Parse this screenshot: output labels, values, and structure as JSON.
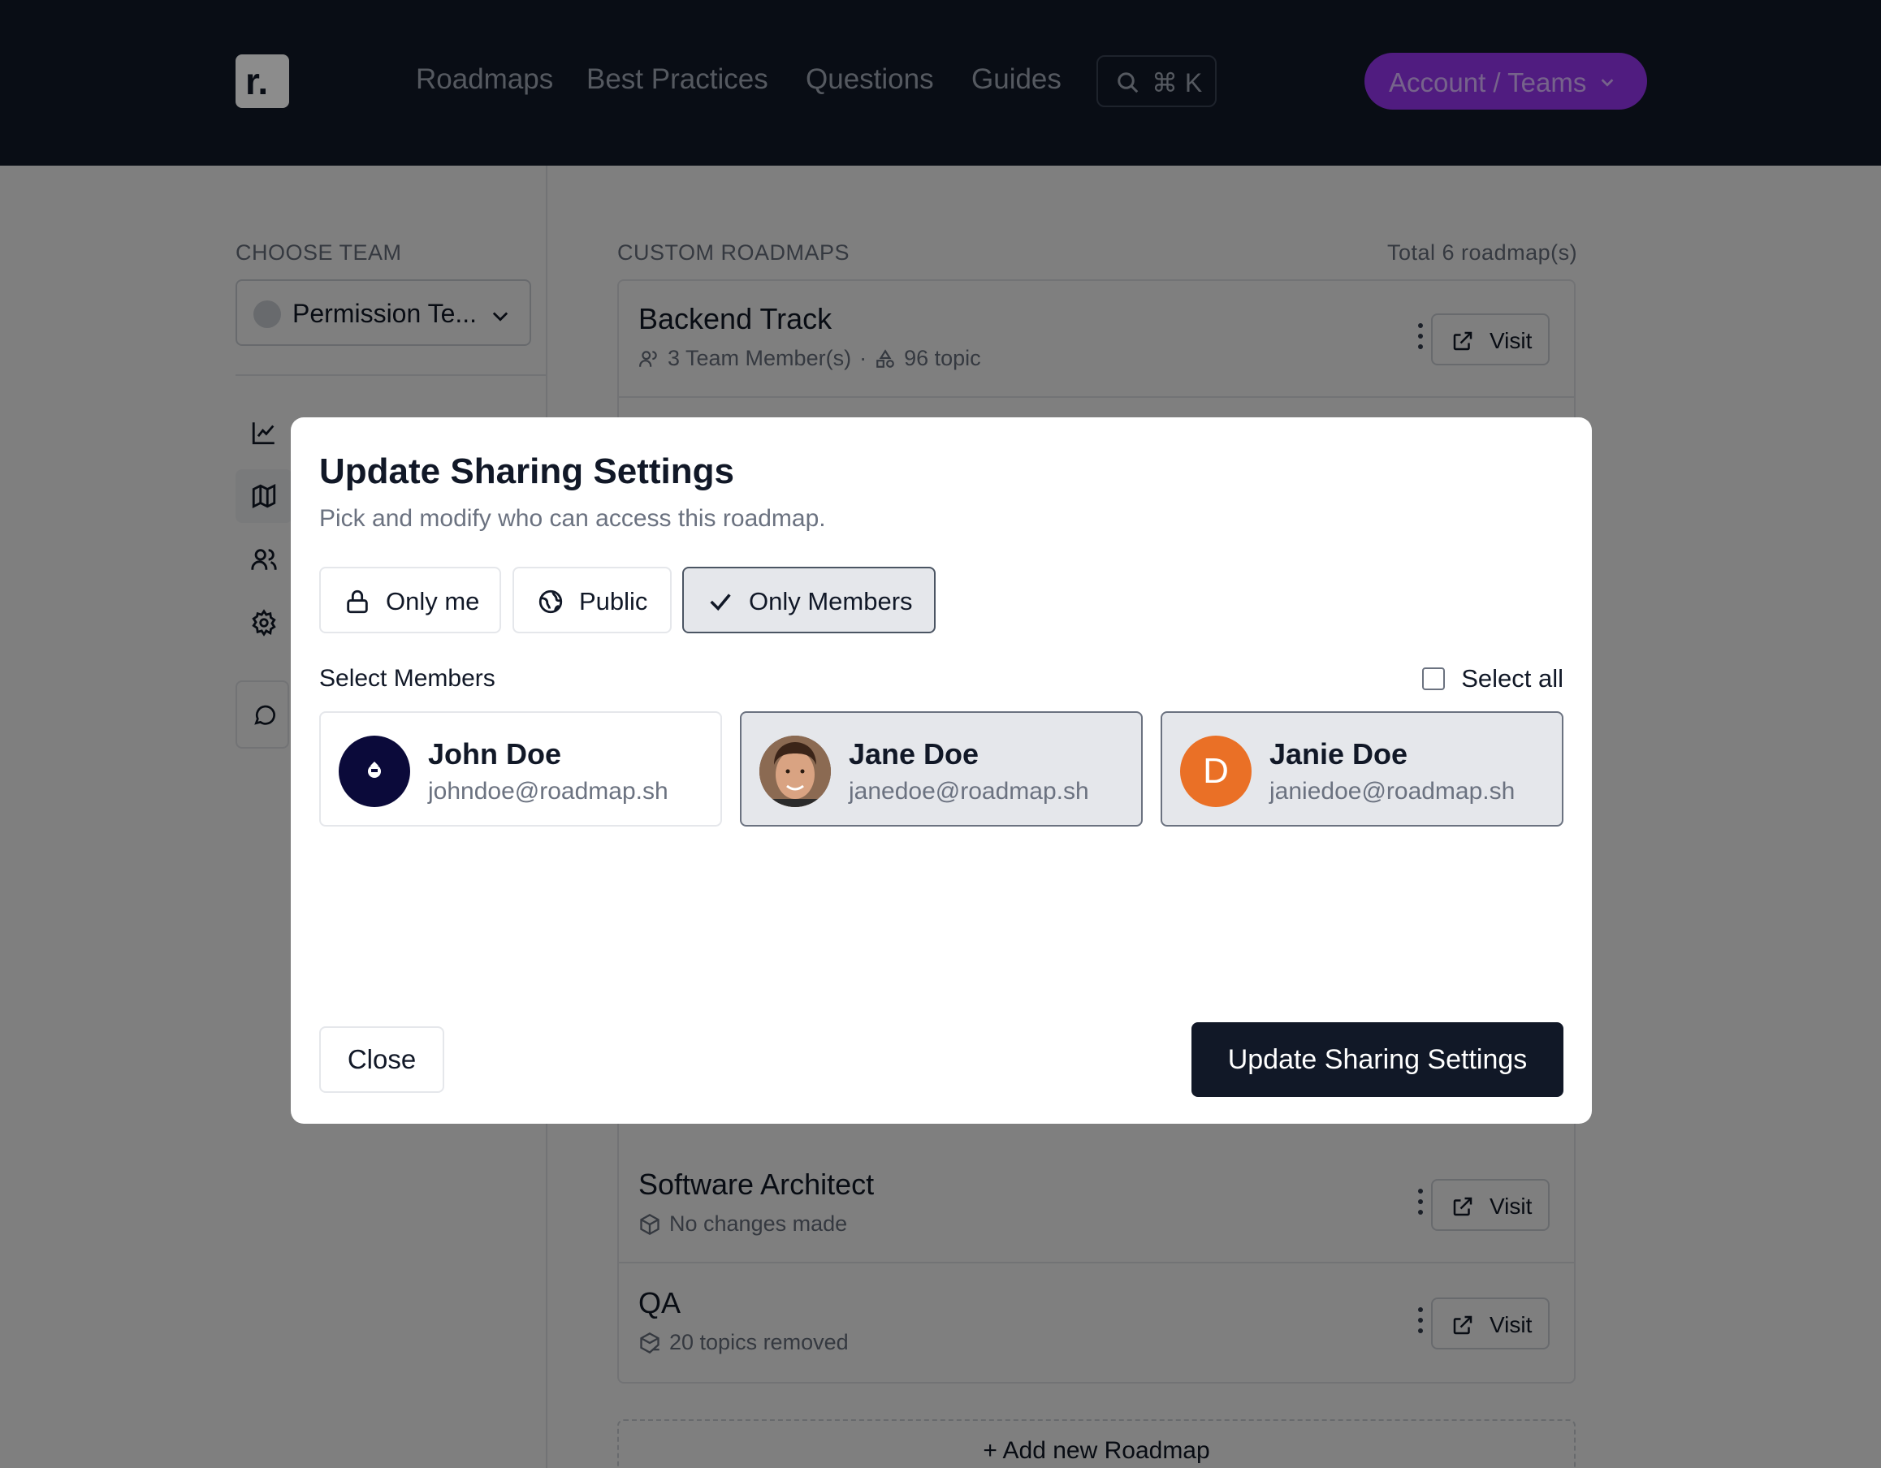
{
  "header": {
    "logo_letter": "r.",
    "nav": [
      "Roadmaps",
      "Best Practices",
      "Questions",
      "Guides"
    ],
    "search_shortcut": "⌘ K",
    "account_label": "Account / Teams"
  },
  "sidebar": {
    "choose_team_label": "CHOOSE TEAM",
    "selected_team": "Permission Te..."
  },
  "main": {
    "section_title": "CUSTOM ROADMAPS",
    "total": "Total 6 roadmap(s)",
    "visit_label": "Visit",
    "roadmaps": [
      {
        "title": "Backend Track",
        "members": "3 Team Member(s)",
        "separator": "·",
        "topics": "96 topic"
      },
      {
        "title": "Software Architect",
        "status": "No changes made"
      },
      {
        "title": "QA",
        "status": "20 topics removed"
      }
    ],
    "add_label": "+ Add new Roadmap"
  },
  "modal": {
    "title": "Update Sharing Settings",
    "subtitle": "Pick and modify who can access this roadmap.",
    "visibility": {
      "only_me": "Only me",
      "public": "Public",
      "only_members": "Only Members",
      "selected": "only_members"
    },
    "select_members_label": "Select Members",
    "select_all_label": "Select all",
    "members": [
      {
        "name": "John Doe",
        "email": "johndoe@roadmap.sh",
        "selected": false
      },
      {
        "name": "Jane Doe",
        "email": "janedoe@roadmap.sh",
        "selected": true
      },
      {
        "name": "Janie Doe",
        "email": "janiedoe@roadmap.sh",
        "initial": "D",
        "selected": true
      }
    ],
    "close_label": "Close",
    "submit_label": "Update Sharing Settings"
  },
  "colors": {
    "header_bg": "#111827",
    "accent_purple": "#9333ea",
    "primary_button": "#111827",
    "avatar_orange": "#ea7026"
  }
}
